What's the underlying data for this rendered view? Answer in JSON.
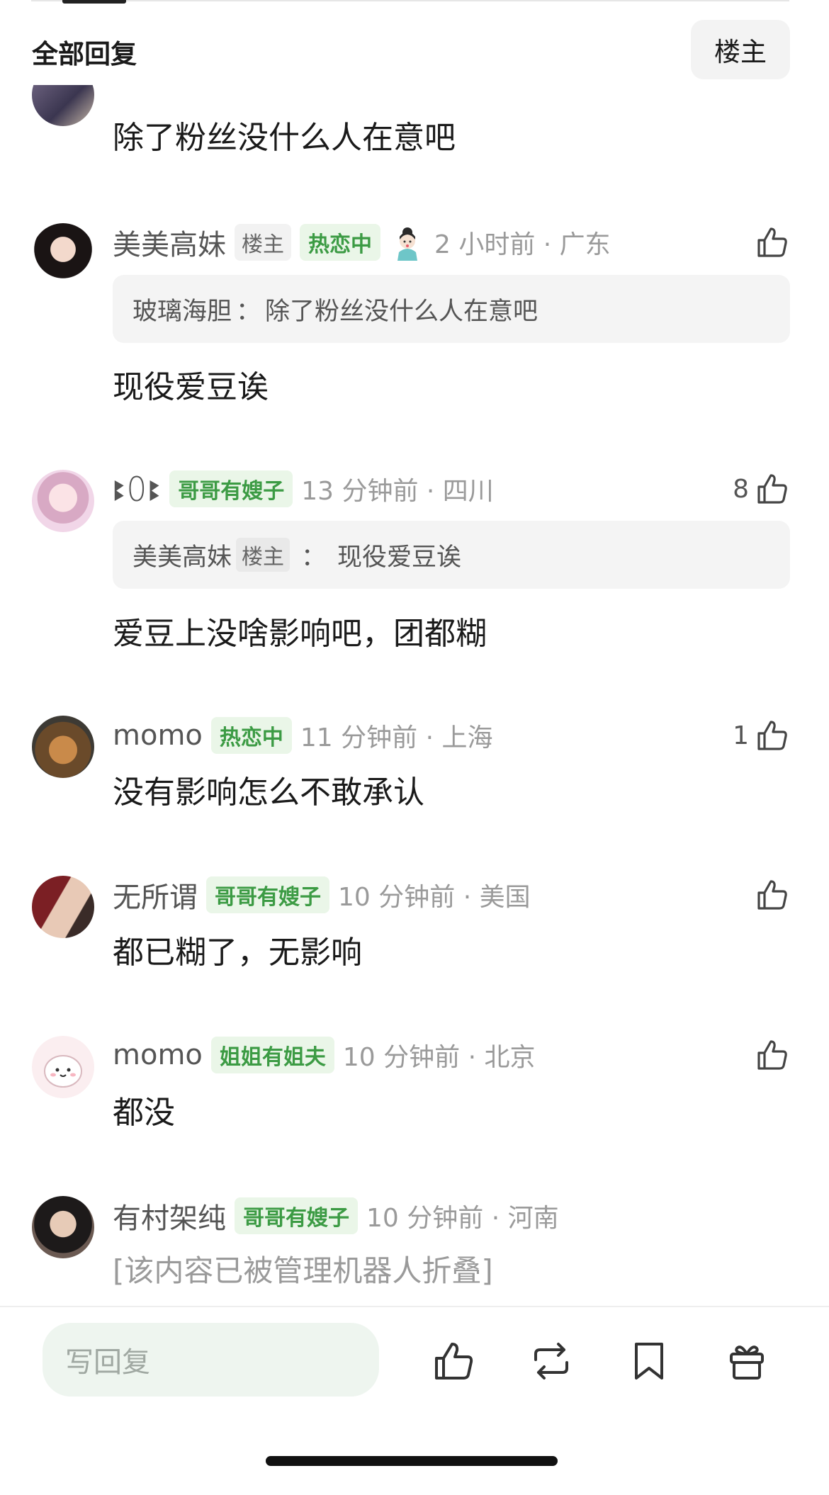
{
  "header": {
    "title": "全部回复",
    "filter_label": "楼主"
  },
  "comments": [
    {
      "body": "除了粉丝没什么人在意吧"
    },
    {
      "nick": "美美高妹",
      "op_tag": "楼主",
      "badge": "热恋中",
      "time": "2 小时前 · 广东",
      "likes": "",
      "quote_user": "玻璃海胆",
      "quote_sep": "：",
      "quote_text": "除了粉丝没什么人在意吧",
      "body": "现役爱豆诶"
    },
    {
      "nick": "ꔪꄲꔪ",
      "badge": "哥哥有嫂子",
      "time": "13 分钟前 · 四川",
      "likes": "8",
      "quote_user": "美美高妹",
      "quote_op": "楼主",
      "quote_sep": "：",
      "quote_text": "现役爱豆诶",
      "body": "爱豆上没啥影响吧，团都糊"
    },
    {
      "nick": "momo",
      "badge": "热恋中",
      "time": "11 分钟前 · 上海",
      "likes": "1",
      "body": "没有影响怎么不敢承认"
    },
    {
      "nick": "无所谓",
      "badge": "哥哥有嫂子",
      "time": "10 分钟前 · 美国",
      "likes": "",
      "body": "都已糊了，无影响"
    },
    {
      "nick": "momo",
      "badge": "姐姐有姐夫",
      "time": "10 分钟前 · 北京",
      "likes": "",
      "body": "都没"
    },
    {
      "nick": "有村架纯",
      "badge": "哥哥有嫂子",
      "time": "10 分钟前 · 河南",
      "likes": "",
      "body": "[该内容已被管理机器人折叠]"
    }
  ],
  "bottom_bar": {
    "reply_placeholder": "写回复",
    "icons": [
      "thumbs-up-icon",
      "repost-icon",
      "bookmark-icon",
      "gift-icon"
    ]
  },
  "colors": {
    "accent_green": "#3c9b44",
    "badge_green_bg": "#eaf6e8",
    "muted": "#9a9a9a"
  }
}
